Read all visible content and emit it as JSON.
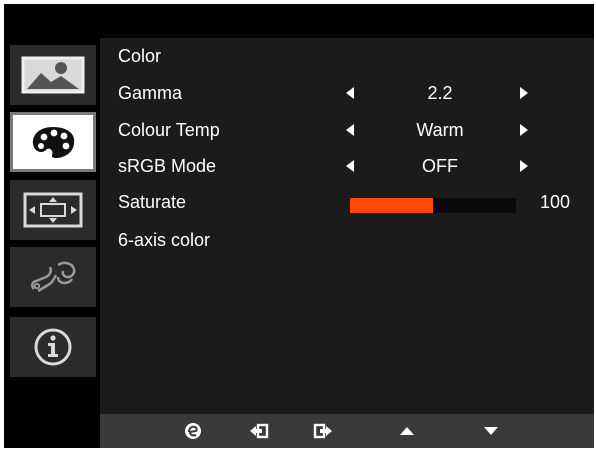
{
  "menu": {
    "section_title": "Color",
    "rows": [
      {
        "label": "Gamma",
        "value": "2.2"
      },
      {
        "label": "Colour Temp",
        "value": "Warm"
      },
      {
        "label": "sRGB Mode",
        "value": "OFF"
      },
      {
        "label": "Saturate",
        "value": "100",
        "level_fraction": 0.5
      },
      {
        "label": "6-axis color"
      }
    ]
  },
  "sidebar": {
    "tabs": [
      {
        "icon": "picture-icon",
        "active": false
      },
      {
        "icon": "color-palette-icon",
        "active": true
      },
      {
        "icon": "screen-position-icon",
        "active": false
      },
      {
        "icon": "settings-wrench-icon",
        "active": false
      },
      {
        "icon": "info-icon",
        "active": false
      }
    ]
  },
  "bottom_bar": {
    "buttons": [
      "auto-adjust-icon",
      "enter-icon",
      "exit-icon",
      "up-arrow-icon",
      "down-arrow-icon"
    ]
  },
  "colors": {
    "accent": "#ff4a00",
    "active_tab": "#ffffff",
    "panel": "#1b1b1b"
  }
}
